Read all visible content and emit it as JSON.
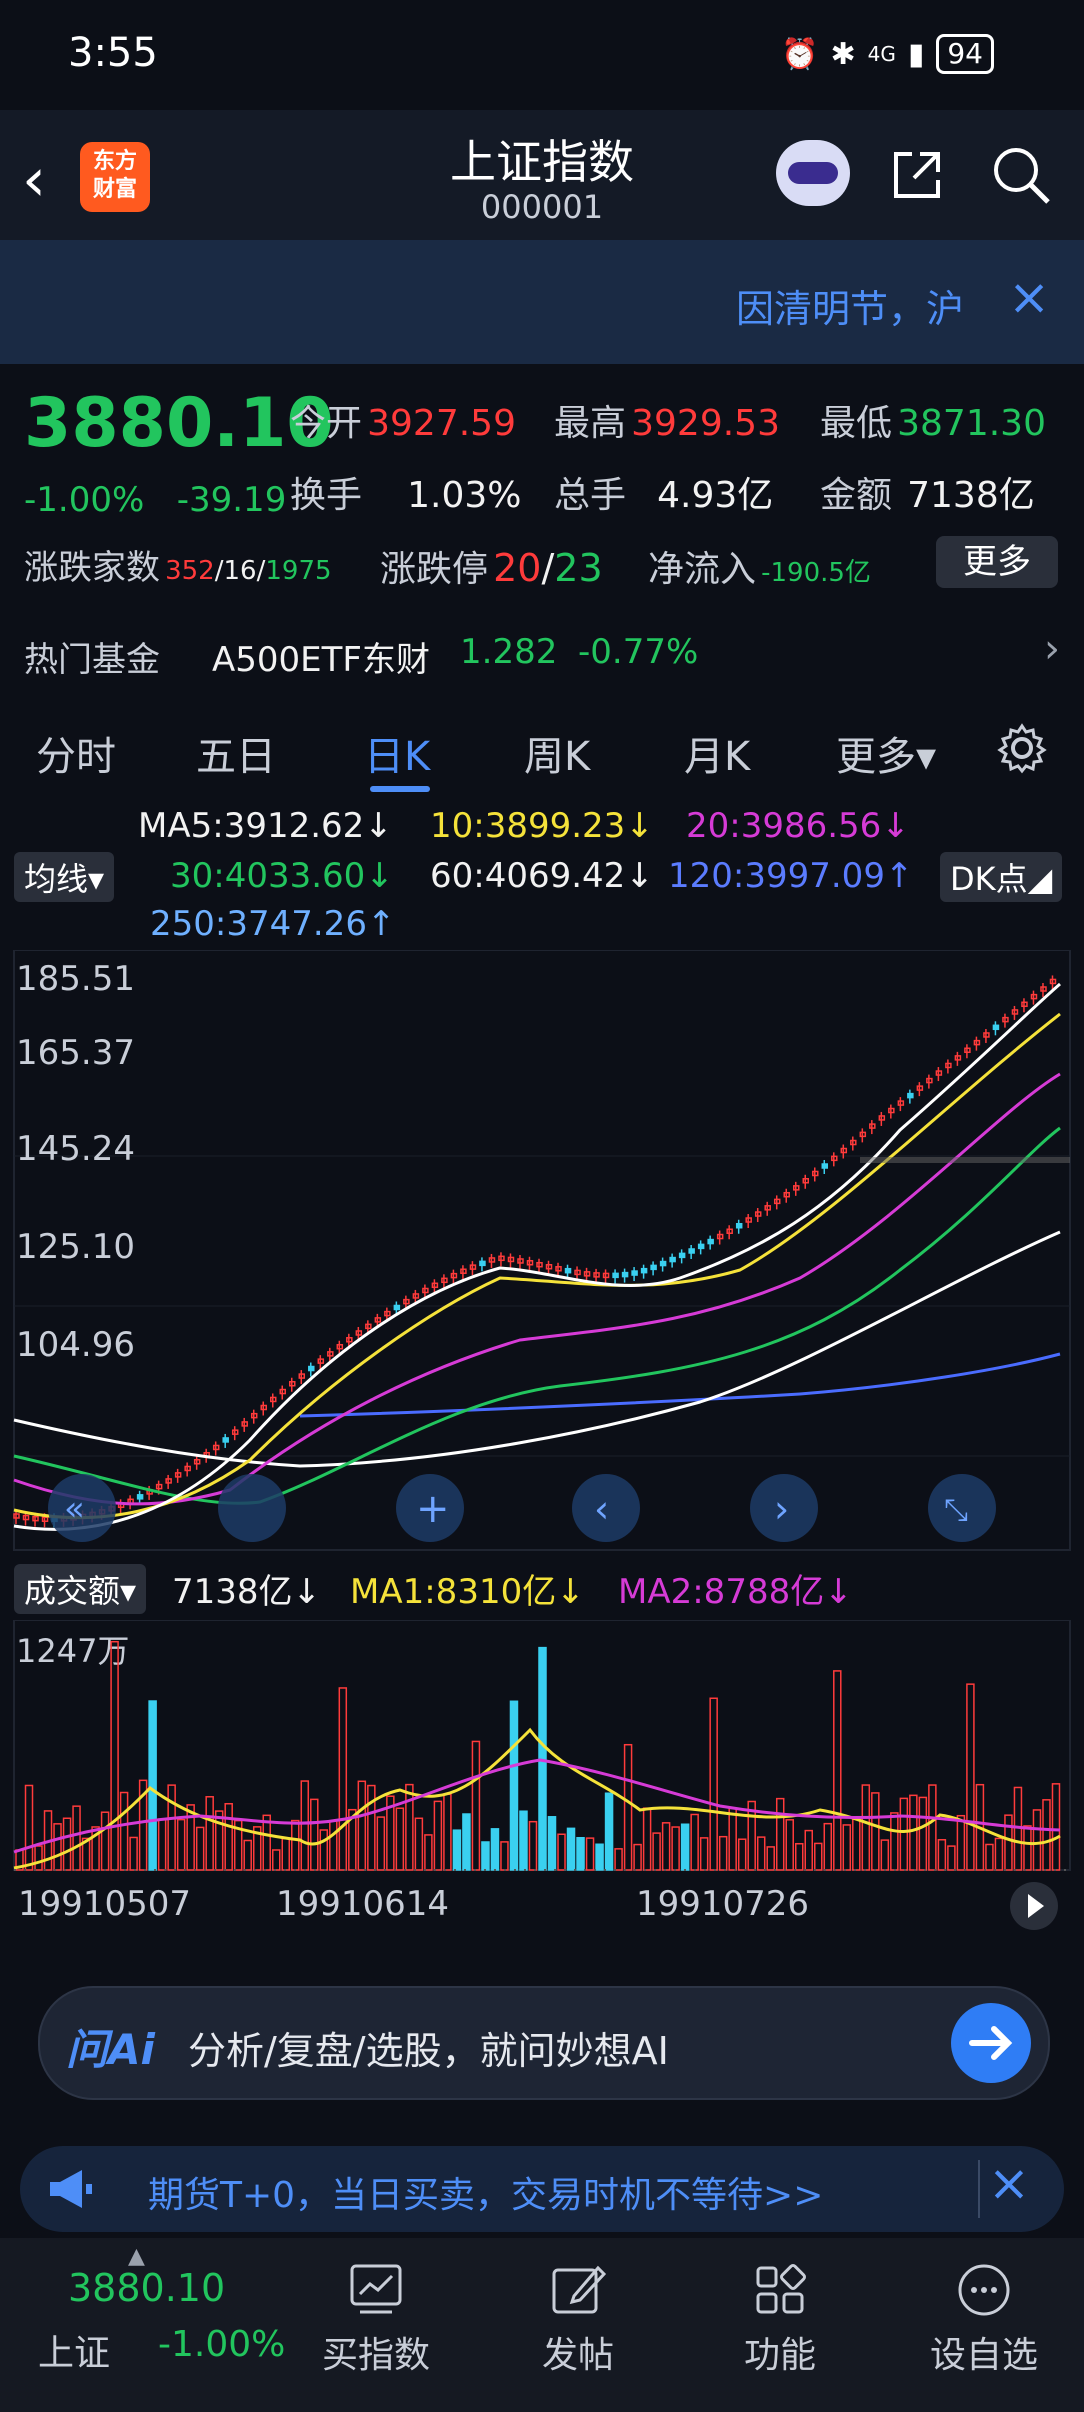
{
  "status_bar": {
    "time": "3:55",
    "signal": "4G",
    "battery": "94"
  },
  "header": {
    "back": "‹",
    "logo_text": "东方\n财富",
    "title": "上证指数",
    "code": "000001"
  },
  "notice": {
    "text": "因清明节，沪",
    "close": "×"
  },
  "quote": {
    "price": "3880.10",
    "change_pct": "-1.00%",
    "change": "-39.19",
    "open_label": "今开",
    "open": "3927.59",
    "high_label": "最高",
    "high": "3929.53",
    "low_label": "最低",
    "low": "3871.30",
    "turnover_label": "换手",
    "turnover": "1.03%",
    "volume_label": "总手",
    "volume": "4.93亿",
    "amount_label": "金额",
    "amount": "7138亿",
    "breadth_label": "涨跌家数",
    "breadth_up": "352",
    "breadth_flat": "16",
    "breadth_down": "1975",
    "limit_label": "涨跌停",
    "limit_up": "20",
    "limit_down": "23",
    "inflow_label": "净流入",
    "inflow": "-190.5亿",
    "more": "更多"
  },
  "fund": {
    "label": "热门基金",
    "name": "A500ETF东财",
    "price": "1.282",
    "change": "-0.77%",
    "arrow": "›"
  },
  "tabs": [
    "分时",
    "五日",
    "日K",
    "周K",
    "月K",
    "更多▾"
  ],
  "active_tab": 2,
  "ma_legend": {
    "toggle": "均线▾",
    "ma5": "MA5:3912.62↓",
    "ma10": "10:3899.23↓",
    "ma20": "20:3986.56↓",
    "ma30": "30:4033.60↓",
    "ma60": "60:4069.42↓",
    "ma120": "120:3997.09↑",
    "ma250": "250:3747.26↑",
    "dk": "DK点◢"
  },
  "chart_data": {
    "type": "line",
    "y_ticks": [
      "185.51",
      "165.37",
      "145.24",
      "125.10",
      "104.96"
    ],
    "ylim": [
      104.96,
      185.51
    ],
    "series": []
  },
  "volume": {
    "toggle": "成交额▾",
    "current": "7138亿↓",
    "ma1": "MA1:8310亿↓",
    "ma2": "MA2:8788亿↓",
    "y_tick": "1247万",
    "x_ticks": [
      "19910507",
      "19910614",
      "19910726"
    ]
  },
  "colors": {
    "up": "#ff3b3b",
    "down": "#22c55e",
    "accent": "#4e8ef7",
    "ma5": "#ffffff",
    "ma10": "#f5e23a",
    "ma20": "#d63bd6",
    "ma30": "#22c55e",
    "ma60": "#ffffff",
    "ma120": "#5b7cff"
  },
  "ai_bar": {
    "logo": "问Ai",
    "placeholder": "分析/复盘/选股，就问妙想AI"
  },
  "promo": {
    "text": "期货T+0，当日买卖，交易时机不等待>>",
    "close": "×"
  },
  "bottom_bar": {
    "index_price": "3880.10",
    "index_name": "上证",
    "index_change": "-1.00%",
    "items": [
      "买指数",
      "发帖",
      "功能",
      "设自选"
    ]
  }
}
